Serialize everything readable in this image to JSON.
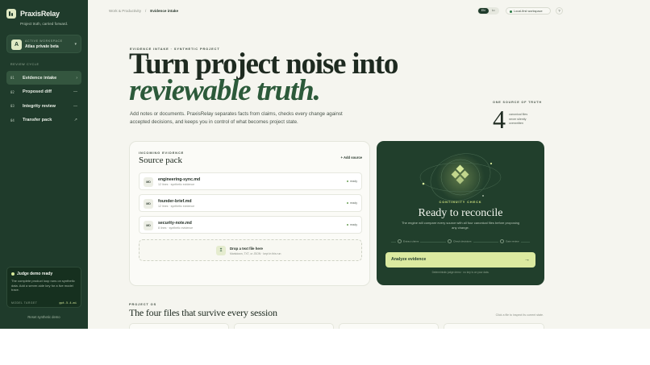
{
  "brand": {
    "name": "PraxisRelay",
    "tagline": "Project truth, carried forward."
  },
  "workspace": {
    "label": "ACTIVE WORKSPACE",
    "avatar": "A",
    "name": "Atlas private beta"
  },
  "sidebar": {
    "section_label": "REVIEW CYCLE",
    "items": [
      {
        "num": "01",
        "label": "Evidence intake",
        "marker": "›",
        "active": true
      },
      {
        "num": "02",
        "label": "Proposed diff",
        "marker": "—"
      },
      {
        "num": "03",
        "label": "Integrity review",
        "marker": "—"
      },
      {
        "num": "04",
        "label": "Transfer pack",
        "marker": "↗"
      }
    ],
    "judge": {
      "title": "Judge demo ready",
      "text": "The complete product loop runs on synthetic data. Add a server-side key for a live model trace.",
      "model_label": "MODEL TARGET",
      "model": "gpt-5.4-mi"
    },
    "reset": "Reset synthetic demo"
  },
  "topbar": {
    "crumb_parent": "Work & Productivity",
    "crumb_sep": "/",
    "crumb_current": "Evidence intake",
    "lang_en": "EN",
    "lang_other": "ko",
    "local_label": "Local-first workspace",
    "help": "?"
  },
  "hero": {
    "eyebrow": "EVIDENCE INTAKE · SYNTHETIC PROJECT",
    "title_line1": "Turn project noise into",
    "title_line2": "reviewable truth.",
    "subtitle": "Add notes or documents. PraxisRelay separates facts from claims, checks every change against accepted decisions, and keeps you in control of what becomes project state."
  },
  "stat": {
    "label": "ONE SOURCE OF TRUTH",
    "value": "4",
    "note": "canonical files never silently overwritten"
  },
  "source_pack": {
    "eyebrow": "INCOMING EVIDENCE",
    "title": "Source pack",
    "add_label": "+ Add source",
    "files": [
      {
        "badge": "MD",
        "name": "engineering-sync.md",
        "meta": "12 lines · synthetic evidence",
        "status": "ready"
      },
      {
        "badge": "MD",
        "name": "founder-brief.md",
        "meta": "12 lines · synthetic evidence",
        "status": "ready"
      },
      {
        "badge": "MD",
        "name": "security-note.md",
        "meta": "8 lines · synthetic evidence",
        "status": "ready"
      }
    ],
    "drop_icon": "↥",
    "drop_title": "Drop a text file here",
    "drop_sub": "Markdown, TXT, or JSON · kept in this run"
  },
  "check": {
    "eyebrow": "CONTINUITY CHECK",
    "title": "Ready to reconcile",
    "subtitle": "The engine will compare every source with all four canonical files before proposing any change.",
    "steps": [
      "Extract claims",
      "Check decisions",
      "Gate review"
    ],
    "button": "Analyze evidence",
    "button_arrow": "→",
    "footnote": "Deterministic judge demo · no key is on your data."
  },
  "project_os": {
    "eyebrow": "PROJECT OS",
    "title": "The four files that survive every session",
    "hint": "Click a file to inspect its current state."
  },
  "colors": {
    "sidebar": "#1f3b2b",
    "accent": "#dbeaa0",
    "panel_dark": "#213f2c",
    "page_bg": "#f5f5ef"
  }
}
